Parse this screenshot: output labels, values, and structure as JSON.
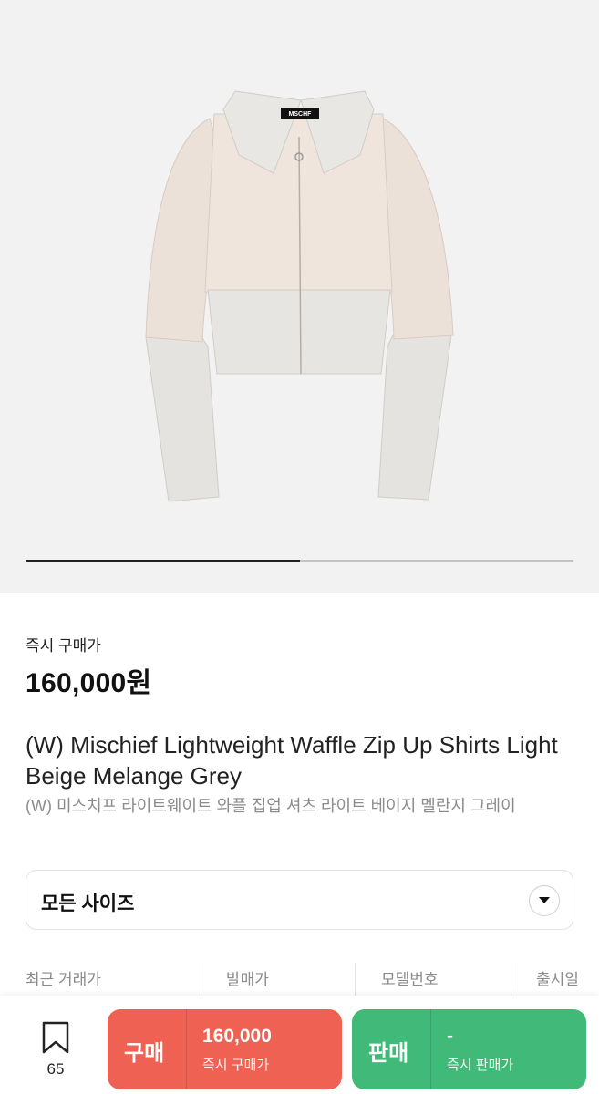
{
  "product_image": {
    "brand_label": "MSCHF",
    "carousel": {
      "current_index": 1,
      "total": 2
    }
  },
  "price": {
    "label": "즉시 구매가",
    "value": "160,000원"
  },
  "title": {
    "english": "(W) Mischief Lightweight Waffle Zip Up Shirts Light Beige Melange Grey",
    "korean": "(W) 미스치프 라이트웨이트 와플 집업 셔츠 라이트 베이지 멜란지 그레이"
  },
  "size_select": {
    "label": "모든 사이즈",
    "icon": "chevron-down-icon"
  },
  "info": {
    "recent_price": "최근 거래가",
    "release_price": "발매가",
    "model_number": "모델번호",
    "release_date": "출시일"
  },
  "bottom_bar": {
    "bookmark_icon": "bookmark-icon",
    "bookmark_count": "65",
    "buy": {
      "label": "구매",
      "price": "160,000",
      "sub": "즉시 구매가"
    },
    "sell": {
      "label": "판매",
      "price": "-",
      "sub": "즉시 판매가"
    }
  },
  "colors": {
    "buy": "#ef6253",
    "sell": "#41b979",
    "background_image": "#f2f2f2"
  }
}
